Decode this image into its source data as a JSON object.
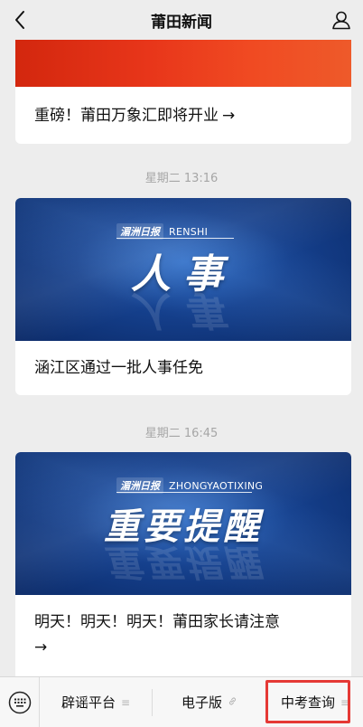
{
  "header": {
    "title": "莆田新闻",
    "back_icon": "chevron-left-icon",
    "profile_icon": "person-icon"
  },
  "feed": {
    "cards": [
      {
        "headline": "重磅！莆田万象汇即将开业",
        "arrow": "→"
      },
      {
        "timestamp": "星期二 13:16",
        "banner_logo": "湄洲日报",
        "banner_sub": "RENSHI",
        "banner_big": "人事",
        "headline": "涵江区通过一批人事任免"
      },
      {
        "timestamp": "星期二 16:45",
        "banner_logo": "湄洲日报",
        "banner_sub": "ZHONGYAOTIXING",
        "banner_big": "重要提醒",
        "headline": "明天！明天！明天！莆田家长请注意",
        "arrow": "→"
      }
    ]
  },
  "bottombar": {
    "keyboard_icon": "keyboard-icon",
    "menus": [
      {
        "label": "辟谣平台",
        "icon": "menu-lines-icon",
        "glyph": "≡"
      },
      {
        "label": "电子版",
        "icon": "link-icon",
        "glyph": "🔗"
      },
      {
        "label": "中考查询",
        "icon": "menu-lines-icon",
        "glyph": "≡"
      }
    ],
    "highlight_color": "#e53935"
  },
  "colors": {
    "background": "#ededed",
    "card": "#ffffff",
    "timestamp": "#a6a6a6",
    "banner_blue": "#15408d"
  }
}
